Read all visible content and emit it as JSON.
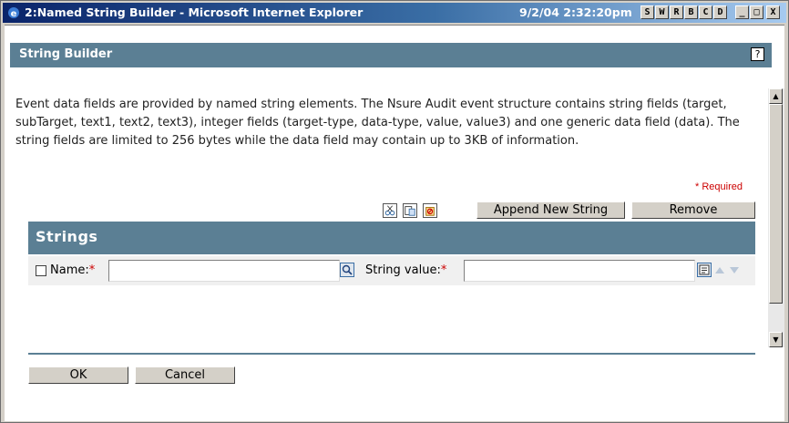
{
  "window": {
    "title": "2:Named String Builder - Microsoft Internet Explorer",
    "timestamp": "9/2/04 2:32:20pm",
    "title_buttons": [
      "S",
      "W",
      "R",
      "B",
      "C",
      "D"
    ],
    "minimize": "_",
    "maximize": "□",
    "close": "X"
  },
  "header": {
    "title": "String Builder",
    "help": "?"
  },
  "description": "Event data fields are provided by named string elements.  The Nsure Audit event structure contains string fields (target, subTarget, text1, text2, text3), integer fields (target-type, data-type, value, value3) and one generic data field (data).  The string fields are limited to 256 bytes while the data field may contain up to 3KB of information.",
  "required_note": "* Required",
  "toolbar": {
    "append_label": "Append New String",
    "remove_label": "Remove"
  },
  "strings": {
    "title": "Strings",
    "row": {
      "name_label": "Name:",
      "name_required": "*",
      "name_value": "",
      "string_value_label": "String value:",
      "string_value_required": "*",
      "string_value": ""
    }
  },
  "footer": {
    "ok_label": "OK",
    "cancel_label": "Cancel"
  },
  "colors": {
    "header_bar": "#5b7f94",
    "title_bar": "#0a246a",
    "required": "#cc0000"
  }
}
